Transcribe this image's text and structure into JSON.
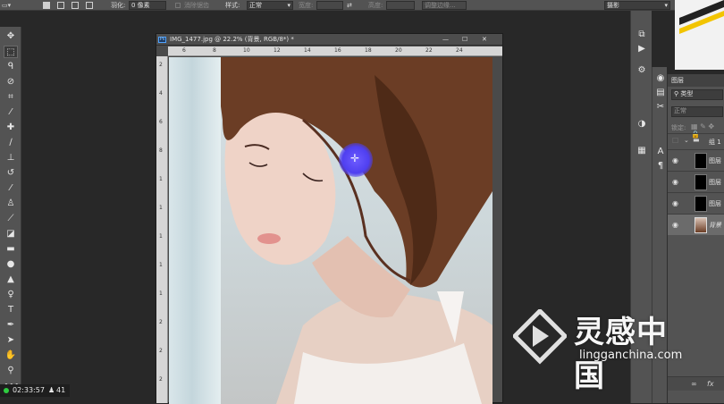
{
  "options_bar": {
    "feather_label": "羽化:",
    "feather_value": "0 像素",
    "anti_alias_label": "消除锯齿",
    "style_label": "样式:",
    "style_value": "正常",
    "width_label": "宽度:",
    "height_label": "高度:",
    "refine_edge_label": "调整边缘...",
    "workspace_value": "摄影"
  },
  "document": {
    "title": "IMG_1477.jpg @ 22.2% (背景, RGB/8*) *",
    "ruler_h": [
      "6",
      "8",
      "10",
      "12",
      "14",
      "16",
      "18",
      "20",
      "22",
      "24"
    ],
    "ruler_v": [
      "2",
      "4",
      "6",
      "8",
      "1",
      "1",
      "1",
      "1",
      "1",
      "2",
      "2",
      "2"
    ]
  },
  "layers_panel": {
    "tab": "图层",
    "filter_kind": "类型",
    "blend_mode": "正常",
    "lock_label": "锁定:",
    "group_name": "组 1",
    "layers": [
      {
        "name": "图层"
      },
      {
        "name": "图层"
      },
      {
        "name": "图层"
      },
      {
        "name": "背景"
      }
    ]
  },
  "status": {
    "time": "02:33:57",
    "count": "41"
  },
  "watermark": {
    "title": "灵感中国",
    "url": "lingganchina.com"
  }
}
